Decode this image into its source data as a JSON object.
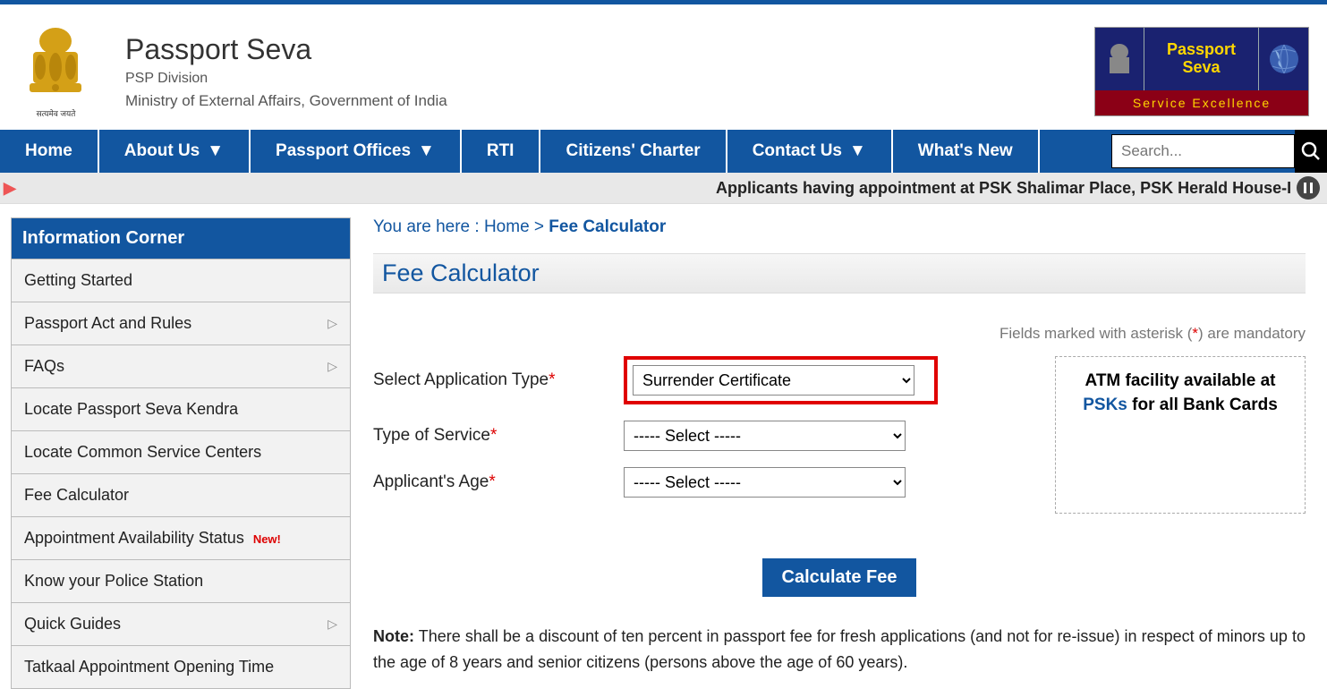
{
  "header": {
    "title": "Passport Seva",
    "subtitle1": "PSP Division",
    "subtitle2": "Ministry of External Affairs, Government of India",
    "emblem_text": "सत्यमेव जयते"
  },
  "badge": {
    "line1": "Passport",
    "line2": "Seva",
    "bottom": "Service Excellence"
  },
  "nav": {
    "home": "Home",
    "about": "About Us",
    "offices": "Passport Offices",
    "rti": "RTI",
    "charter": "Citizens' Charter",
    "contact": "Contact Us",
    "whatsnew": "What's New",
    "search_placeholder": "Search..."
  },
  "ticker": "Applicants having appointment at PSK Shalimar Place, PSK Herald House-I",
  "sidebar": {
    "header": "Information Corner",
    "items": [
      {
        "label": "Getting Started",
        "chev": false,
        "new": false
      },
      {
        "label": "Passport Act and Rules",
        "chev": true,
        "new": false
      },
      {
        "label": "FAQs",
        "chev": true,
        "new": false
      },
      {
        "label": "Locate Passport Seva Kendra",
        "chev": false,
        "new": false
      },
      {
        "label": "Locate Common Service Centers",
        "chev": false,
        "new": false
      },
      {
        "label": "Fee Calculator",
        "chev": false,
        "new": false
      },
      {
        "label": "Appointment Availability Status",
        "chev": false,
        "new": true,
        "new_text": "New!"
      },
      {
        "label": "Know your Police Station",
        "chev": false,
        "new": false
      },
      {
        "label": "Quick Guides",
        "chev": true,
        "new": false
      },
      {
        "label": "Tatkaal Appointment Opening Time",
        "chev": false,
        "new": false
      }
    ]
  },
  "breadcrumb": {
    "prefix": "You are here : ",
    "home": "Home",
    "sep": " > ",
    "current": "Fee Calculator"
  },
  "page_title": "Fee Calculator",
  "mandatory": {
    "pre": "Fields marked with asterisk (",
    "ast": "*",
    "post": ") are mandatory"
  },
  "form": {
    "app_type_label": "Select Application Type",
    "app_type_value": "Surrender Certificate",
    "service_label": "Type of Service",
    "age_label": "Applicant's Age",
    "placeholder_option": "----- Select -----",
    "calc_button": "Calculate Fee"
  },
  "atm": {
    "line1": "ATM facility available at ",
    "psk": "PSKs",
    "line2": " for all Bank Cards"
  },
  "note": {
    "label": "Note:",
    "text": " There shall be a discount of ten percent in passport fee for fresh applications (and not for re-issue) in respect of minors up to the age of 8 years and senior citizens (persons above the age of 60 years)."
  }
}
